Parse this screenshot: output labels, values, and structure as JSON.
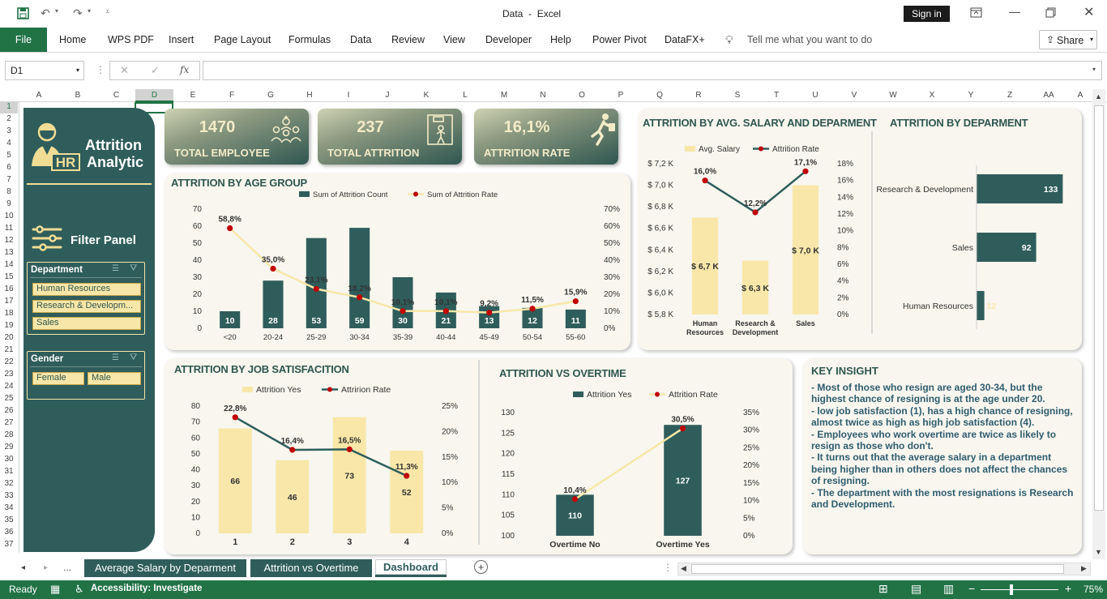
{
  "window": {
    "doc_title": "Data",
    "app": "Excel",
    "sign_in": "Sign in",
    "share": "Share"
  },
  "ribbon": {
    "file": "File",
    "tabs": [
      "Home",
      "WPS PDF",
      "Insert",
      "Page Layout",
      "Formulas",
      "Data",
      "Review",
      "View",
      "Developer",
      "Help",
      "Power Pivot",
      "DataFX+"
    ],
    "tell_me": "Tell me what you want to do"
  },
  "formula_bar": {
    "name_box": "D1",
    "fx": "fx",
    "formula": ""
  },
  "columns": [
    "A",
    "B",
    "C",
    "D",
    "E",
    "F",
    "G",
    "H",
    "I",
    "J",
    "K",
    "L",
    "M",
    "N",
    "O",
    "P",
    "Q",
    "R",
    "S",
    "T",
    "U",
    "V",
    "W",
    "X",
    "Y",
    "Z",
    "AA",
    "A"
  ],
  "rows": [
    "1",
    "2",
    "3",
    "4",
    "5",
    "6",
    "7",
    "8",
    "9",
    "10",
    "11",
    "12",
    "13",
    "14",
    "15",
    "16",
    "17",
    "18",
    "19",
    "20",
    "21",
    "22",
    "23",
    "24",
    "25",
    "26",
    "27",
    "28",
    "29",
    "30",
    "31",
    "32",
    "33",
    "34",
    "35",
    "36",
    "37"
  ],
  "sidebar": {
    "logo_badge": "HR",
    "title_line1": "Attrition",
    "title_line2": "Analytic",
    "filter_title": "Filter Panel",
    "department_slicer": {
      "title": "Department",
      "items": [
        "Human Resources",
        "Research & Developm...",
        "Sales"
      ]
    },
    "gender_slicer": {
      "title": "Gender",
      "items": [
        "Female",
        "Male"
      ]
    }
  },
  "kpis": [
    {
      "value": "1470",
      "label": "TOTAL EMPLOYEE",
      "icon": "team-icon"
    },
    {
      "value": "237",
      "label": "TOTAL ATTRITION",
      "icon": "exit-icon"
    },
    {
      "value": "16,1%",
      "label": "ATTRITION RATE",
      "icon": "leaving-icon"
    }
  ],
  "insight": {
    "title": "KEY INSIGHT",
    "lines": [
      "- Most of those who resign are aged 30-34, but the highest chance of resigning is at the age under 20.",
      "- low job satisfaction (1), has a high chance of resigning, almost twice as high as high job satisfaction (4).",
      "- Employees who work overtime are twice as likely to resign as those who don't.",
      "- It turns out that the average salary in a department being higher than in others does not affect the chances of resigning.",
      "- The department with the most resignations is Research and Development."
    ]
  },
  "sheet_tabs": [
    "Average Salary by Deparment",
    "Attrition vs Overtime",
    "Dashboard"
  ],
  "status": {
    "ready": "Ready",
    "accessibility": "Accessibility: Investigate",
    "zoom": "75%"
  },
  "colors": {
    "teal": "#2f5d5c",
    "cream": "#f8e7a8",
    "red": "#c00000",
    "excel_green": "#217346"
  },
  "chart_data": [
    {
      "id": "age",
      "type": "bar",
      "title": "ATTRITION BY AGE GROUP",
      "categories": [
        "<20",
        "20-24",
        "25-29",
        "30-34",
        "35-39",
        "40-44",
        "45-49",
        "50-54",
        "55-60"
      ],
      "series": [
        {
          "name": "Sum of Attrition Count",
          "values": [
            10,
            28,
            53,
            59,
            30,
            21,
            13,
            12,
            11
          ]
        },
        {
          "name": "Sum of Attrition Rate",
          "values": [
            58.8,
            35.0,
            23.1,
            18.2,
            10.1,
            10.1,
            9.2,
            11.5,
            15.9
          ],
          "labels": [
            "58,8%",
            "35,0%",
            "23,1%",
            "18,2%",
            "10,1%",
            "10,1%",
            "9,2%",
            "11,5%",
            "15,9%"
          ]
        }
      ],
      "y_left_ticks": [
        "0",
        "10",
        "20",
        "30",
        "40",
        "50",
        "60",
        "70"
      ],
      "y_right_ticks": [
        "0%",
        "10%",
        "20%",
        "30%",
        "40%",
        "50%",
        "60%",
        "70%"
      ],
      "ylim": [
        0,
        70
      ]
    },
    {
      "id": "salary",
      "type": "bar",
      "title": "ATTRITION BY AVG. SALARY AND DEPARMENT",
      "categories": [
        "Human Resources",
        "Research & Development",
        "Sales"
      ],
      "category_lines": [
        [
          "Human",
          "Resources"
        ],
        [
          "Research &",
          "Development"
        ],
        [
          "Sales"
        ]
      ],
      "series": [
        {
          "name": "Avg. Salary",
          "values": [
            6.7,
            6.3,
            7.0
          ],
          "labels": [
            "$ 6,7 K",
            "$ 6,3 K",
            "$ 7,0 K"
          ]
        },
        {
          "name": "Attrition Rate",
          "values": [
            16.0,
            12.2,
            17.1
          ],
          "labels": [
            "16,0%",
            "12,2%",
            "17,1%"
          ]
        }
      ],
      "y_left_ticks": [
        "$ 5,8 K",
        "$ 6,0 K",
        "$ 6,2 K",
        "$ 6,4 K",
        "$ 6,6 K",
        "$ 6,8 K",
        "$ 7,0 K",
        "$ 7,2 K"
      ],
      "y_right_ticks": [
        "0%",
        "2%",
        "4%",
        "6%",
        "8%",
        "10%",
        "12%",
        "14%",
        "16%",
        "18%"
      ],
      "ylim": [
        5.8,
        7.2
      ]
    },
    {
      "id": "dept",
      "type": "bar",
      "title": "ATTRITION BY DEPARMENT",
      "categories": [
        "Research & Development",
        "Sales",
        "Human Resources"
      ],
      "values": [
        133,
        92,
        12
      ],
      "orientation": "horizontal"
    },
    {
      "id": "job",
      "type": "bar",
      "title": "ATTRITION BY JOB SATISFACITION",
      "categories": [
        "1",
        "2",
        "3",
        "4"
      ],
      "series": [
        {
          "name": "Attrition Yes",
          "values": [
            66,
            46,
            73,
            52
          ]
        },
        {
          "name": "Attririon Rate",
          "values": [
            22.8,
            16.4,
            16.5,
            11.3
          ],
          "labels": [
            "22,8%",
            "16,4%",
            "16,5%",
            "11,3%"
          ]
        }
      ],
      "y_left_ticks": [
        "0",
        "10",
        "20",
        "30",
        "40",
        "50",
        "60",
        "70",
        "80"
      ],
      "y_right_ticks": [
        "0%",
        "5%",
        "10%",
        "15%",
        "20%",
        "25%"
      ],
      "ylim": [
        0,
        80
      ]
    },
    {
      "id": "overtime",
      "type": "bar",
      "title": "ATTRITION VS OVERTIME",
      "categories": [
        "Overtime No",
        "Overtime Yes"
      ],
      "series": [
        {
          "name": "Attrition Yes",
          "values": [
            110,
            127
          ]
        },
        {
          "name": "Attrition Rate",
          "values": [
            10.4,
            30.5
          ],
          "labels": [
            "10,4%",
            "30,5%"
          ]
        }
      ],
      "y_left_ticks": [
        "100",
        "105",
        "110",
        "115",
        "120",
        "125",
        "130"
      ],
      "y_right_ticks": [
        "0%",
        "5%",
        "10%",
        "15%",
        "20%",
        "25%",
        "30%",
        "35%"
      ],
      "ylim": [
        100,
        130
      ]
    }
  ]
}
